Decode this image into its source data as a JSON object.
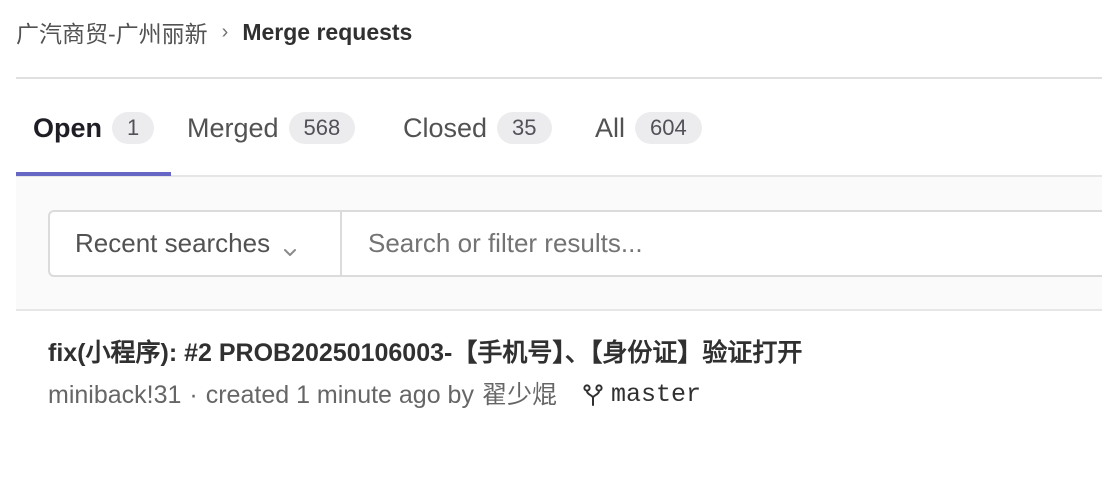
{
  "breadcrumb": {
    "group": "广汽商贸-广州丽新",
    "separator": "›",
    "current": "Merge requests"
  },
  "tabs": [
    {
      "label": "Open",
      "count": "1",
      "active": true
    },
    {
      "label": "Merged",
      "count": "568",
      "active": false
    },
    {
      "label": "Closed",
      "count": "35",
      "active": false
    },
    {
      "label": "All",
      "count": "604",
      "active": false
    }
  ],
  "filter": {
    "recent_searches_label": "Recent searches",
    "search_placeholder": "Search or filter results..."
  },
  "merge_requests": [
    {
      "title": "fix(小程序): #2 PROB20250106003-【手机号】、【身份证】验证打开",
      "reference": "miniback!31",
      "meta_separator": "·",
      "created_text": "created 1 minute ago by",
      "author": "翟少焜",
      "target_branch": "master"
    }
  ],
  "colors": {
    "accent_underline": "#6666c4",
    "badge_bg": "#ececef"
  }
}
